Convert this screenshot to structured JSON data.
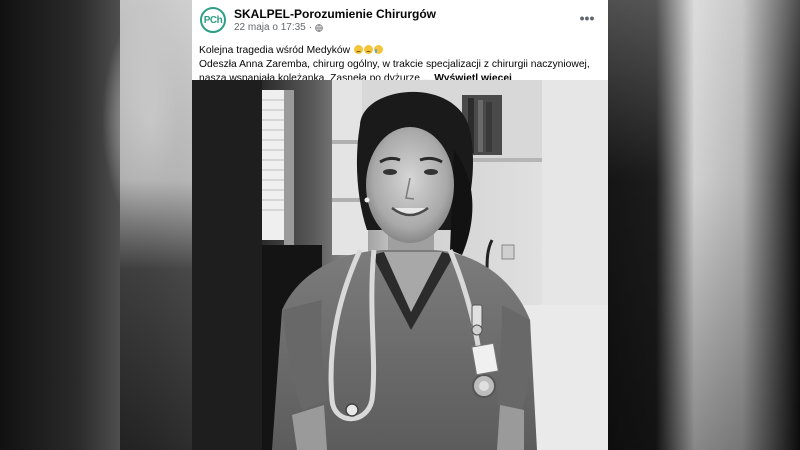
{
  "post": {
    "page_name": "SKALPEL-Porozumienie Chirurgów",
    "avatar_text": "PCh",
    "date": "22 maja o 17:35",
    "separator": "·",
    "more_label": "•••",
    "line1": "Kolejna tragedia wśród Medyków",
    "line2": "Odeszła Anna Zaremba, chirurg ogólny, w trakcie specjalizacji z chirurgii naczyniowej, nasza wspaniała koleżanka. Zasnęła po dyżurze ...",
    "see_more": "Wyświetl więcej"
  },
  "icons": {
    "avatar": "logo-icon",
    "privacy": "globe-icon",
    "more": "more-options-icon",
    "emoji1": "sad-face-icon",
    "emoji2": "sad-face-icon",
    "emoji3": "crying-face-icon"
  },
  "colors": {
    "brand": "#2e9e86",
    "text": "#050505",
    "meta": "#65676b"
  }
}
